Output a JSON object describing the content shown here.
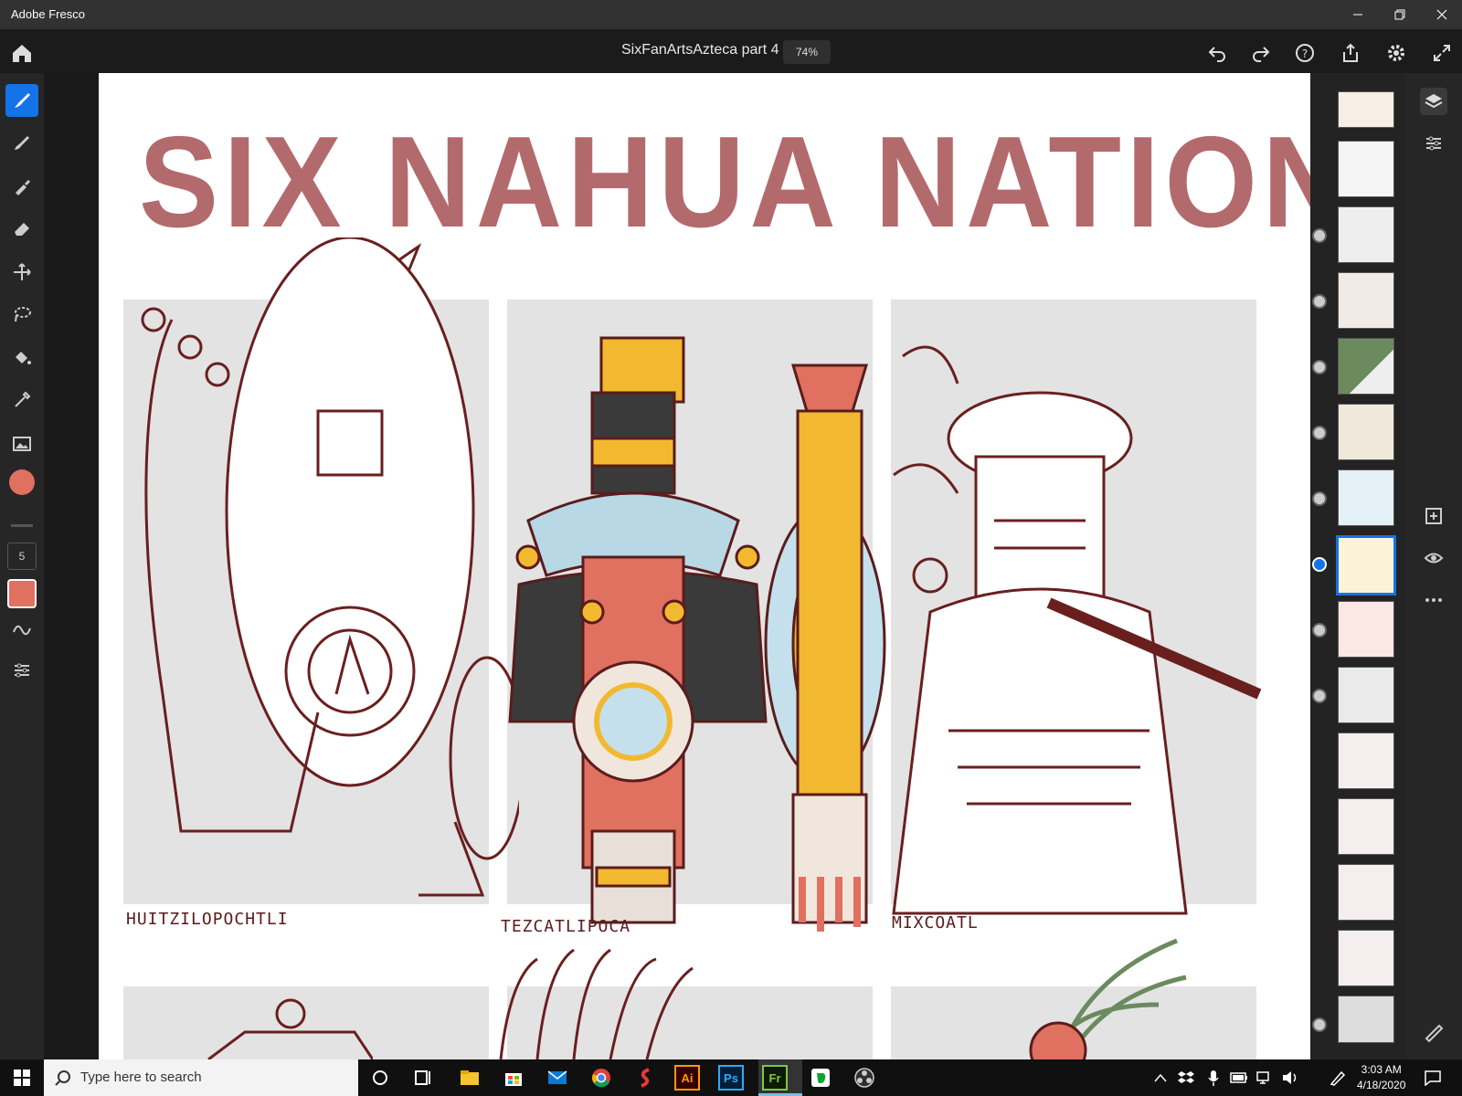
{
  "window": {
    "app_title": "Adobe Fresco"
  },
  "toolbar": {
    "document_title": "SixFanArtsAzteca part 4",
    "zoom": "74%"
  },
  "brush": {
    "size": "5",
    "color": "#e07060"
  },
  "artwork": {
    "title": "SIX NAHUA NATIONS",
    "captions": [
      "HUITZILOPOCHTLI",
      "TEZCATLIPOCA",
      "MIXCOATL"
    ]
  },
  "taskbar": {
    "search_placeholder": "Type here to search",
    "time": "3:03 AM",
    "date": "4/18/2020"
  },
  "colors": {
    "accent": "#1473e6",
    "title_pink": "#b36a6c"
  }
}
